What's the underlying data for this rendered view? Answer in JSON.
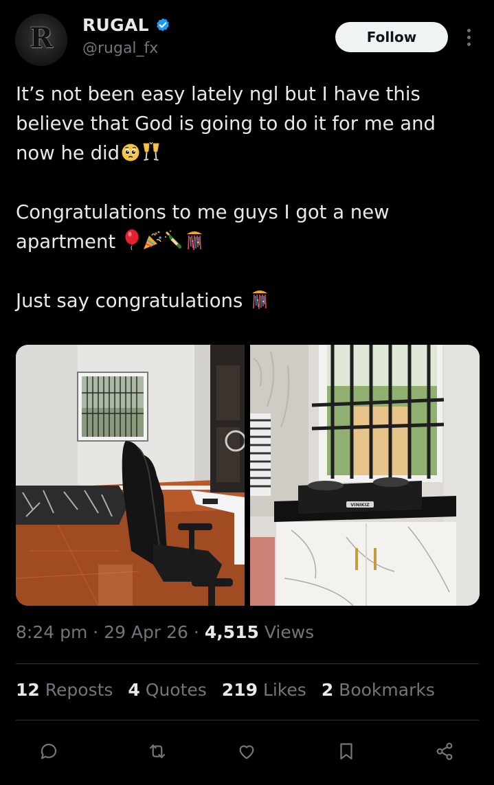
{
  "author": {
    "display_name": "RUGAL",
    "handle": "@rugal_fx",
    "avatar_letter": "R",
    "verified": true,
    "verified_color": "#1d9bf0"
  },
  "follow_button": {
    "label": "Follow"
  },
  "more_menu_icon": "more-vertical-icon",
  "tweet": {
    "paragraph_1": "It’s not been easy lately ngl but I have this believe that God is going to do it for me and now he did",
    "paragraph_1_emojis": [
      "pleading-face-emoji",
      "clinking-glasses-emoji"
    ],
    "paragraph_2": "Congratulations to me guys I got a new apartment",
    "paragraph_2_emojis": [
      "balloon-emoji",
      "party-popper-emoji",
      "champagne-bottle-emoji",
      "confetti-ball-emoji"
    ],
    "paragraph_3": "Just say congratulations",
    "paragraph_3_emojis": [
      "confetti-ball-emoji"
    ]
  },
  "media": {
    "photos": [
      "bedroom-photo",
      "kitchen-photo"
    ],
    "stove_brand": "VINIKIZ"
  },
  "meta": {
    "time": "8:24 pm",
    "date": "29 Apr 26",
    "views_count": "4,515",
    "views_label": "Views",
    "separator": "·"
  },
  "stats": {
    "reposts": {
      "count": "12",
      "label": "Reposts"
    },
    "quotes": {
      "count": "4",
      "label": "Quotes"
    },
    "likes": {
      "count": "219",
      "label": "Likes"
    },
    "bookmarks": {
      "count": "2",
      "label": "Bookmarks"
    }
  },
  "actions": [
    "reply-icon",
    "repost-icon",
    "like-icon",
    "bookmark-icon",
    "share-icon"
  ],
  "colors": {
    "background": "#000000",
    "text_primary": "#e7e9ea",
    "text_secondary": "#71767b",
    "divider": "#2f3336",
    "follow_bg": "#eff3f4"
  }
}
